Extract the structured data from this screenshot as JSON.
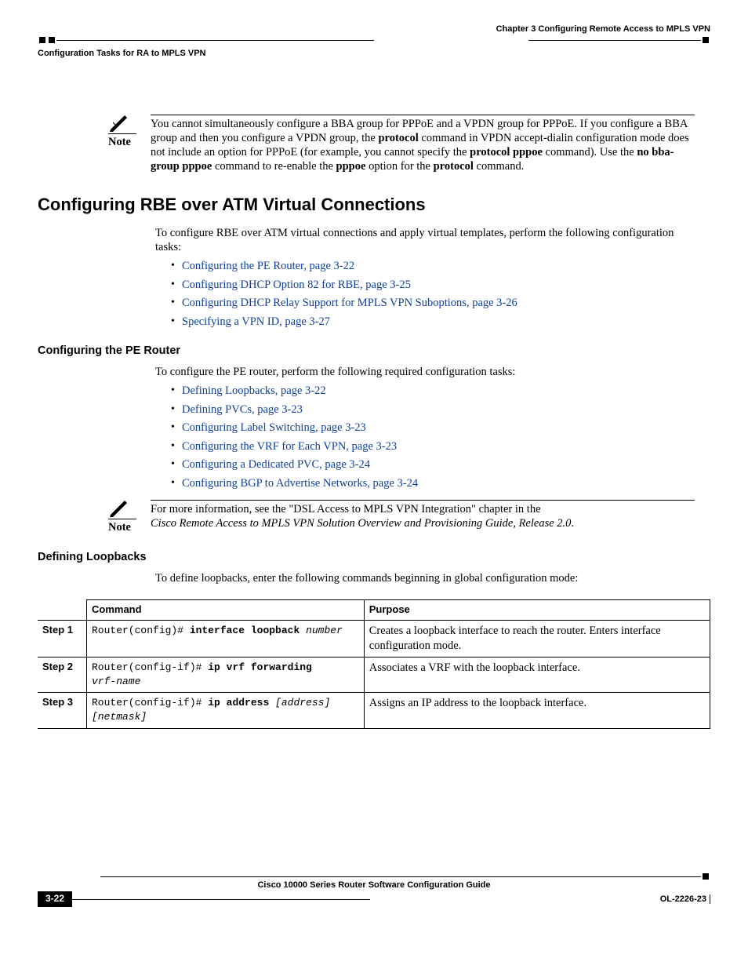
{
  "header": {
    "chapter": "Chapter 3      Configuring Remote Access to MPLS VPN",
    "section": "Configuration Tasks for RA to MPLS VPN"
  },
  "note1": {
    "label": "Note",
    "seg1": "You cannot simultaneously configure a BBA group for PPPoE and a VPDN group for PPPoE. If you configure a BBA group and then you configure a VPDN group, the ",
    "b1": "protocol",
    "seg2": " command in VPDN accept-dialin configuration mode does not include an option for PPPoE (for example, you cannot specify the ",
    "b2": "protocol pppoe",
    "seg3": " command). Use the ",
    "b3": "no bba-group pppoe",
    "seg4": " command to re-enable the ",
    "b4": "pppoe",
    "seg5": " option for the ",
    "b5": "protocol",
    "seg6": " command."
  },
  "h1": "Configuring RBE over ATM Virtual Connections",
  "intro1": "To configure RBE over ATM virtual connections and apply virtual templates, perform the following configuration tasks:",
  "list1": [
    "Configuring the PE Router, page 3-22",
    "Configuring DHCP Option 82 for RBE, page 3-25",
    "Configuring DHCP Relay Support for MPLS VPN Suboptions, page 3-26",
    "Specifying a VPN ID, page 3-27"
  ],
  "h2a": "Configuring the PE Router",
  "intro2": "To configure the PE router, perform the following required configuration tasks:",
  "list2": [
    "Defining Loopbacks, page 3-22",
    "Defining PVCs, page 3-23",
    "Configuring Label Switching, page 3-23",
    "Configuring the VRF for Each VPN, page 3-23",
    "Configuring a Dedicated PVC, page 3-24",
    "Configuring BGP to Advertise Networks, page 3-24"
  ],
  "note2": {
    "label": "Note",
    "seg1": "For more information, see the \"DSL Access to MPLS VPN Integration\" chapter in the ",
    "it1": "Cisco Remote Access to MPLS VPN Solution Overview and Provisioning Guide, Release 2.0",
    "seg2": "."
  },
  "h2b": "Defining Loopbacks",
  "intro3": "To define loopbacks, enter the following commands beginning in global configuration mode:",
  "table": {
    "headers": {
      "command": "Command",
      "purpose": "Purpose"
    },
    "rows": [
      {
        "step": "Step 1",
        "cmd": {
          "prompt": "Router(config)# ",
          "bold": "interface loopback",
          "arg": " number"
        },
        "purpose": "Creates a loopback interface to reach the router. Enters interface configuration mode."
      },
      {
        "step": "Step 2",
        "cmd": {
          "prompt": "Router(config-if)# ",
          "bold": "ip vrf forwarding",
          "arg": " vrf-name"
        },
        "purpose": "Associates a VRF with the loopback interface."
      },
      {
        "step": "Step 3",
        "cmd": {
          "prompt": "Router(config-if)# ",
          "bold": "ip address",
          "arg": " [address] [netmask]"
        },
        "purpose": "Assigns an IP address to the loopback interface."
      }
    ]
  },
  "footer": {
    "title": "Cisco 10000 Series Router Software Configuration Guide",
    "page": "3-22",
    "doc": "OL-2226-23"
  }
}
